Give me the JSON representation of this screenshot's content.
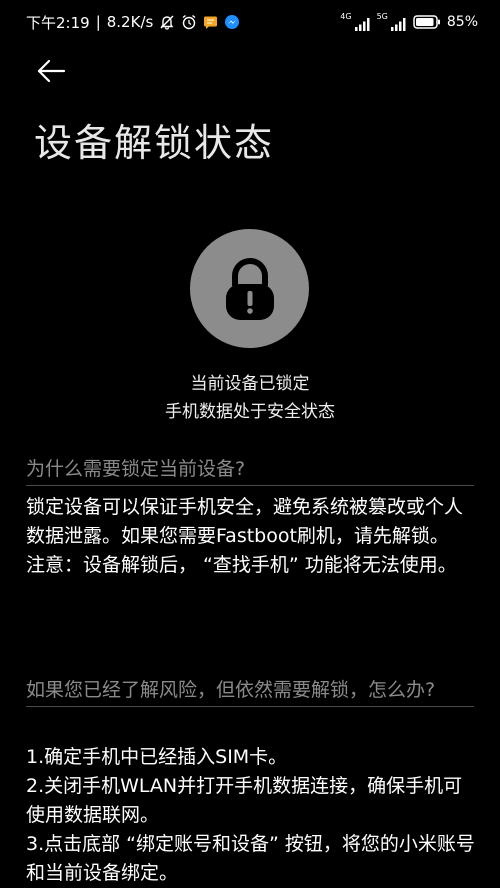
{
  "status_bar": {
    "time": "下午2:19",
    "separator": "|",
    "net_speed": "8.2K/s",
    "sim1_label": "4G",
    "sim2_label": "5G",
    "battery_percent": "85%",
    "icons": [
      "bell-off-icon",
      "alarm-clock-icon",
      "chat-notification-icon",
      "messenger-icon",
      "signal-icon",
      "battery-icon"
    ],
    "colors": {
      "notification_icon": "#f5a623",
      "messenger_icon": "#1e90ff"
    }
  },
  "header": {
    "back_icon": "arrow-left-icon",
    "title": "设备解锁状态"
  },
  "lock": {
    "icon": "padlock-exclamation-icon",
    "circle_color": "#8c8c8c",
    "line1": "当前设备已锁定",
    "line2": "手机数据处于安全状态"
  },
  "sections": [
    {
      "heading": "为什么需要锁定当前设备?",
      "paragraphs": [
        "锁定设备可以保证手机安全，避免系统被篡改或个人数据泄露。如果您需要Fastboot刷机，请先解锁。",
        "注意：设备解锁后， “查找手机” 功能将无法使用。"
      ]
    },
    {
      "heading": "如果您已经了解风险，但依然需要解锁，怎么办?",
      "paragraphs": [
        "1.确定手机中已经插入SIM卡。",
        "2.关闭手机WLAN并打开手机数据连接，确保手机可使用数据联网。",
        "3.点击底部 “绑定账号和设备” 按钮，将您的小米账号和当前设备绑定。"
      ]
    }
  ]
}
